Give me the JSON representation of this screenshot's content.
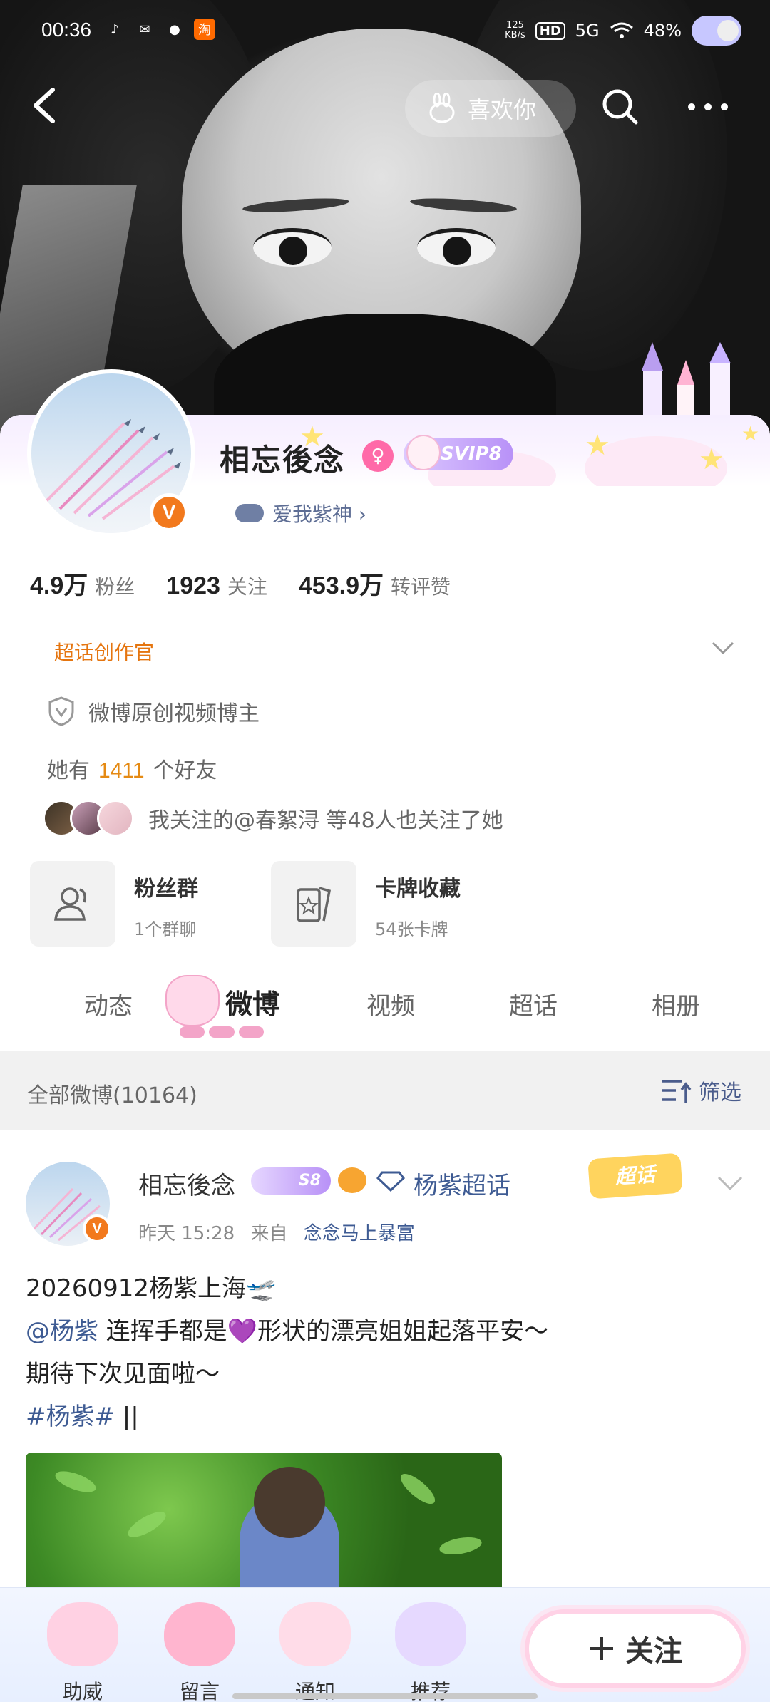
{
  "status_bar": {
    "time": "00:36",
    "network_speed": "125\nKB/s",
    "hd": "HD",
    "signal": "5G",
    "battery": "48%"
  },
  "header": {
    "like_button": "喜欢你"
  },
  "profile": {
    "name": "相忘後念",
    "svip": "SVIP8",
    "fan_tag": "爱我紫神 ›",
    "stats": [
      {
        "value": "4.9万",
        "label": "粉丝"
      },
      {
        "value": "1923",
        "label": "关注"
      },
      {
        "value": "453.9万",
        "label": "转评赞"
      }
    ],
    "creator_title": "超话创作官",
    "original_label": "微博原创视频博主",
    "friends_prefix": "她有",
    "friends_count": "1411",
    "friends_suffix": "个好友",
    "mutual_text": "我关注的@春絮浔 等48人也关注了她",
    "features": [
      {
        "title": "粉丝群",
        "sub": "1个群聊"
      },
      {
        "title": "卡牌收藏",
        "sub": "54张卡牌"
      }
    ]
  },
  "tabs": [
    "动态",
    "微博",
    "视频",
    "超话",
    "相册"
  ],
  "filter": {
    "all_label": "全部微博(10164)",
    "filter_button": "筛选"
  },
  "post": {
    "author": "相忘後念",
    "level_badge": "S8",
    "topic": "杨紫超话",
    "chaohua_tag": "超话",
    "time": "昨天 15:28",
    "from_prefix": "来自",
    "source": "念念马上暴富",
    "line1": "20260912杨紫上海🛫",
    "mention": "@杨紫",
    "line2_rest": " 连挥手都是💜形状的漂亮姐姐起落平安～",
    "line3": "期待下次见面啦～",
    "hashtag": "#杨紫#",
    "line4_rest": " ||"
  },
  "bottom_bar": {
    "items": [
      "助威",
      "留言",
      "通知",
      "推荐"
    ],
    "follow": "关注"
  },
  "colors": {
    "accent_orange": "#e5750f",
    "link_blue": "#3e5b93",
    "svip_purple": "#b891f7",
    "verify_orange": "#f2791d"
  }
}
